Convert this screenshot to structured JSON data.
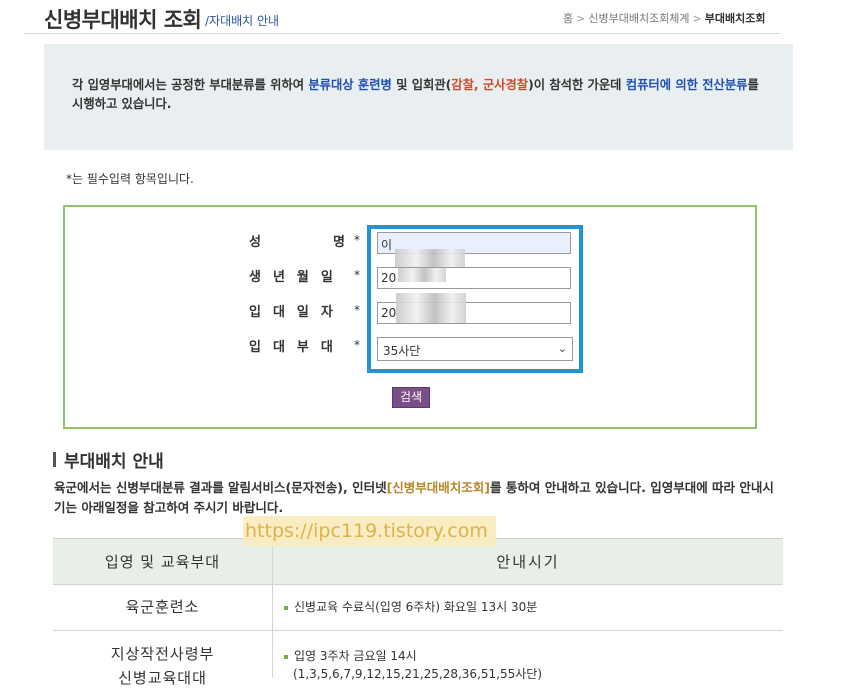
{
  "header": {
    "title": "신병부대배치 조회",
    "subtitle": "/자대배치 안내",
    "breadcrumb": [
      "홈",
      "신병부대배치조회체계",
      "부대배치조회"
    ],
    "breadcrumb_sep": ">"
  },
  "notice": {
    "p1": "각 입영부대에서는 공정한 부대분류를 위하여 ",
    "hl1": "분류대상 훈련병",
    "p2": " 및 입회관(",
    "hl2": "감찰, 군사경찰",
    "p3": ")이 참석한 가운데 ",
    "hl3": "컴퓨터에 의한 전산분류",
    "p4": "를 시행하고 있습니다."
  },
  "required_note": "*는 필수입력 항목입니다.",
  "form": {
    "labels": {
      "name": "성    명",
      "birth": "생년월일",
      "enlist": "입대일자",
      "unit": "입대부대"
    },
    "required_mark": "*",
    "name_value": "이",
    "birth_value": "20",
    "enlist_value": "20",
    "unit_value": "35사단",
    "search_label": "검색"
  },
  "guide": {
    "title": "부대배치 안내",
    "text1": "육군에서는 신병부대분류 결과를 알림서비스(문자전송), 인터넷",
    "link": "[신병부대배치조회]",
    "text2": "를 통하여 안내하고 있습니다. 입영부대에 따라 안내시기는 아래일정을 참고하여 주시기 바랍니다."
  },
  "watermark": "https://ipc119.tistory.com",
  "table": {
    "headers": [
      "입영 및 교육부대",
      "안내시기"
    ],
    "rows": [
      {
        "unit": "육군훈련소",
        "lines": [
          "신병교육 수료식(입영 6주차) 화요일 13시 30분"
        ]
      },
      {
        "unit": "지상작전사령부",
        "unit2": "신병교육대대",
        "lines": [
          "입영 3주차 금요일 14시",
          "(1,3,5,6,7,9,12,15,21,25,28,36,51,55사단)"
        ]
      }
    ]
  },
  "colors": {
    "accent_blue": "#1f95d6",
    "form_border": "#8fc46a",
    "search_btn": "#7a4e86",
    "highlight_red": "#d04a2a"
  }
}
